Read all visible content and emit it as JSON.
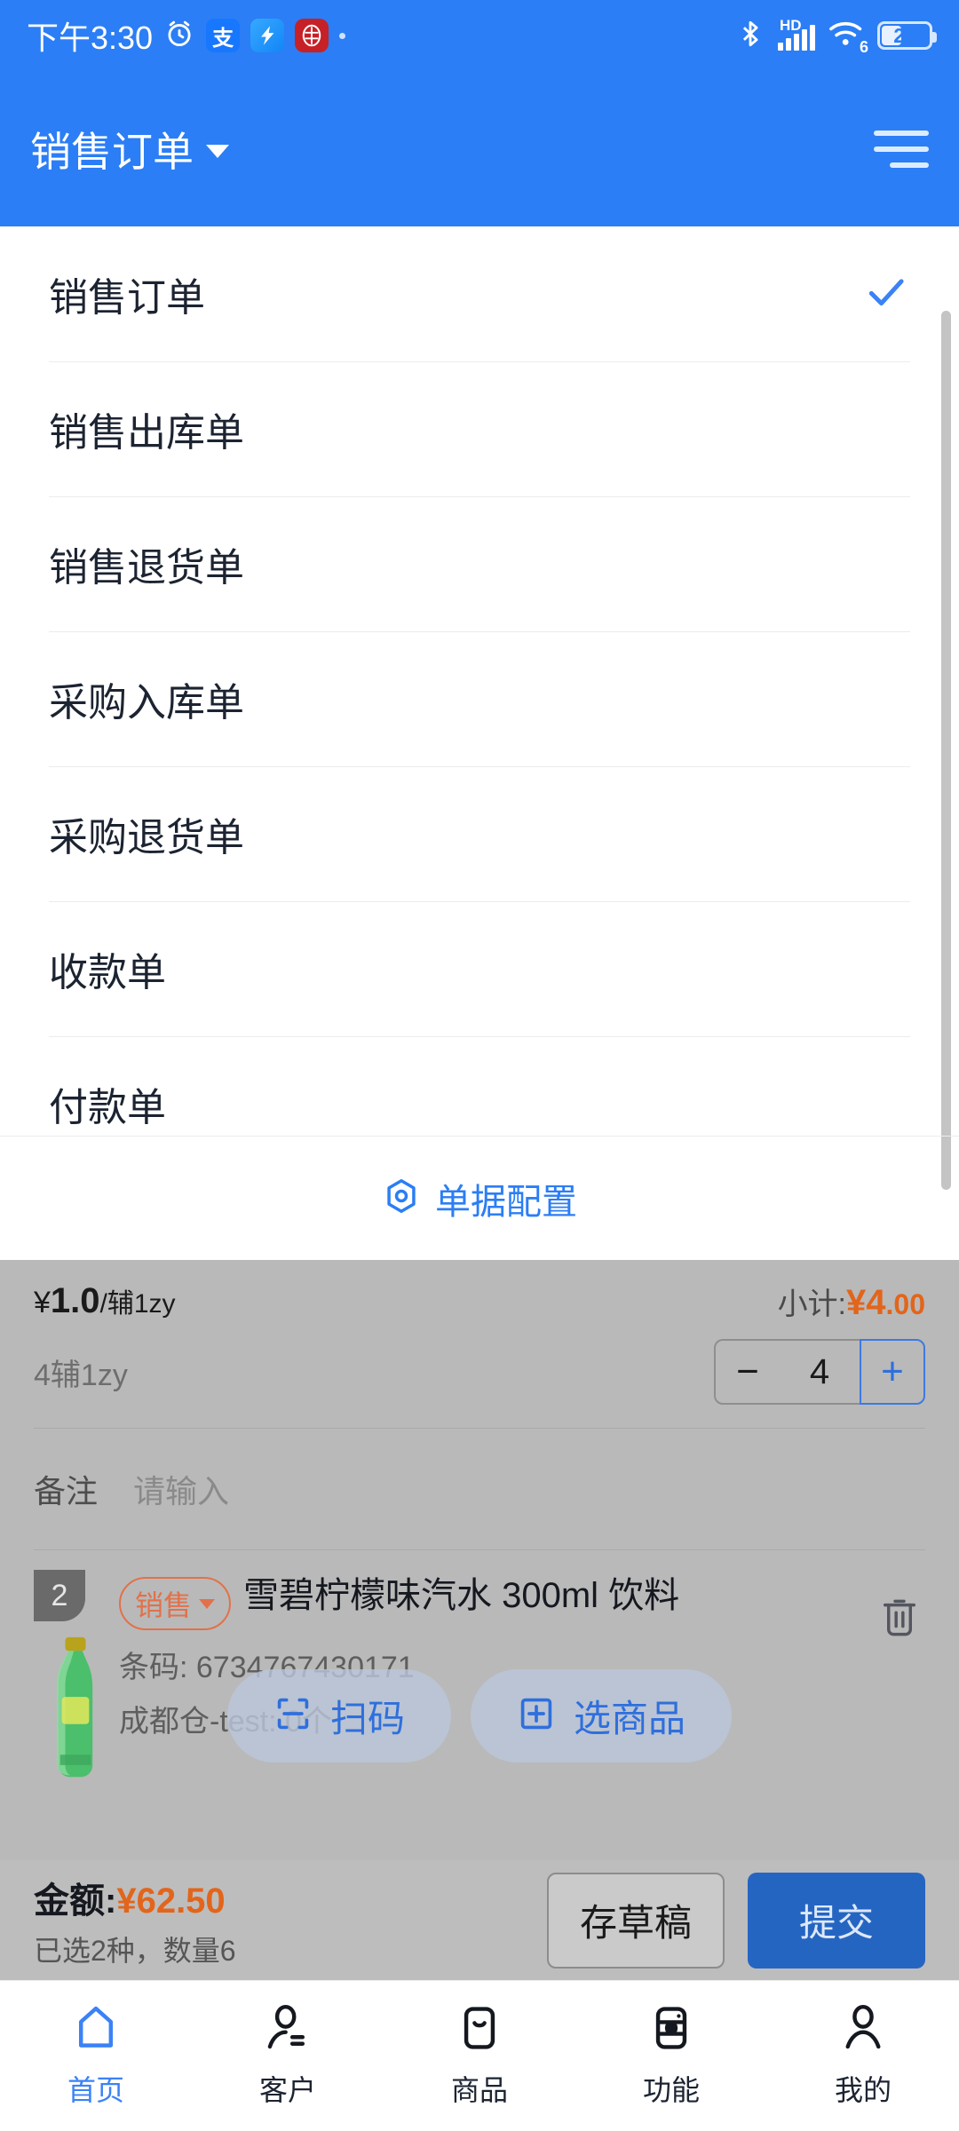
{
  "status_bar": {
    "time": "下午3:30",
    "icons": [
      "alarm-clock-icon",
      "alipay-icon",
      "dingtalk-icon",
      "citic-bank-icon",
      "dot-icon"
    ],
    "alipay_glyph": "支",
    "network_label": "HD",
    "wifi_generation": "6",
    "battery_percent": "27"
  },
  "header": {
    "title": "销售订单",
    "menu_icon": "hamburger-menu-icon",
    "caret_icon": "caret-down-icon"
  },
  "dropdown": {
    "items": [
      {
        "label": "销售订单",
        "selected": true
      },
      {
        "label": "销售出库单",
        "selected": false
      },
      {
        "label": "销售退货单",
        "selected": false
      },
      {
        "label": "采购入库单",
        "selected": false
      },
      {
        "label": "采购退货单",
        "selected": false
      },
      {
        "label": "收款单",
        "selected": false
      },
      {
        "label": "付款单",
        "selected": false
      }
    ],
    "footer": {
      "label": "单据配置",
      "icon": "hexagon-config-icon"
    },
    "check_icon": "check-mark-icon"
  },
  "order_line_partial": {
    "unit_price": "¥1.0/辅1zy",
    "unit_price_currency": "¥",
    "unit_price_value": "1.0",
    "unit_price_unit": "/辅1zy",
    "subtotal_label": "小计:",
    "subtotal_currency": "¥",
    "subtotal_int": "4",
    "subtotal_dec": ".00",
    "quantity_text": "4辅1zy",
    "stepper": {
      "minus_label": "−",
      "value": "4",
      "plus_label": "+"
    }
  },
  "remark": {
    "label": "备注",
    "placeholder": "请输入",
    "value": ""
  },
  "product_item": {
    "index_badge": "2",
    "tag": "销售",
    "tag_caret_icon": "caret-down-icon",
    "name": "雪碧柠檬味汽水 300ml 饮料",
    "barcode_line": "条码: 6734767430171",
    "stock_line": "成都仓-test: 0个",
    "delete_icon": "trash-icon",
    "thumbnail": "sprite-bottle-image"
  },
  "floating_actions": [
    {
      "label": "扫码",
      "icon": "scan-code-icon"
    },
    {
      "label": "选商品",
      "icon": "plus-square-icon"
    }
  ],
  "summary": {
    "amount_label": "金额:",
    "amount_currency": "¥",
    "amount_value": "62.50",
    "selection_text": "已选2种，数量6",
    "draft_button": "存草稿",
    "submit_button": "提交"
  },
  "bottom_nav": [
    {
      "label": "首页",
      "icon": "home-icon",
      "active": true
    },
    {
      "label": "客户",
      "icon": "customer-icon",
      "active": false
    },
    {
      "label": "商品",
      "icon": "product-icon",
      "active": false
    },
    {
      "label": "功能",
      "icon": "function-icon",
      "active": false
    },
    {
      "label": "我的",
      "icon": "profile-icon",
      "active": false
    }
  ],
  "colors": {
    "primary": "#2b7ef5",
    "accent_orange": "#e2651b",
    "tag_orange": "#e2714a",
    "submit_blue": "#2565c2"
  }
}
